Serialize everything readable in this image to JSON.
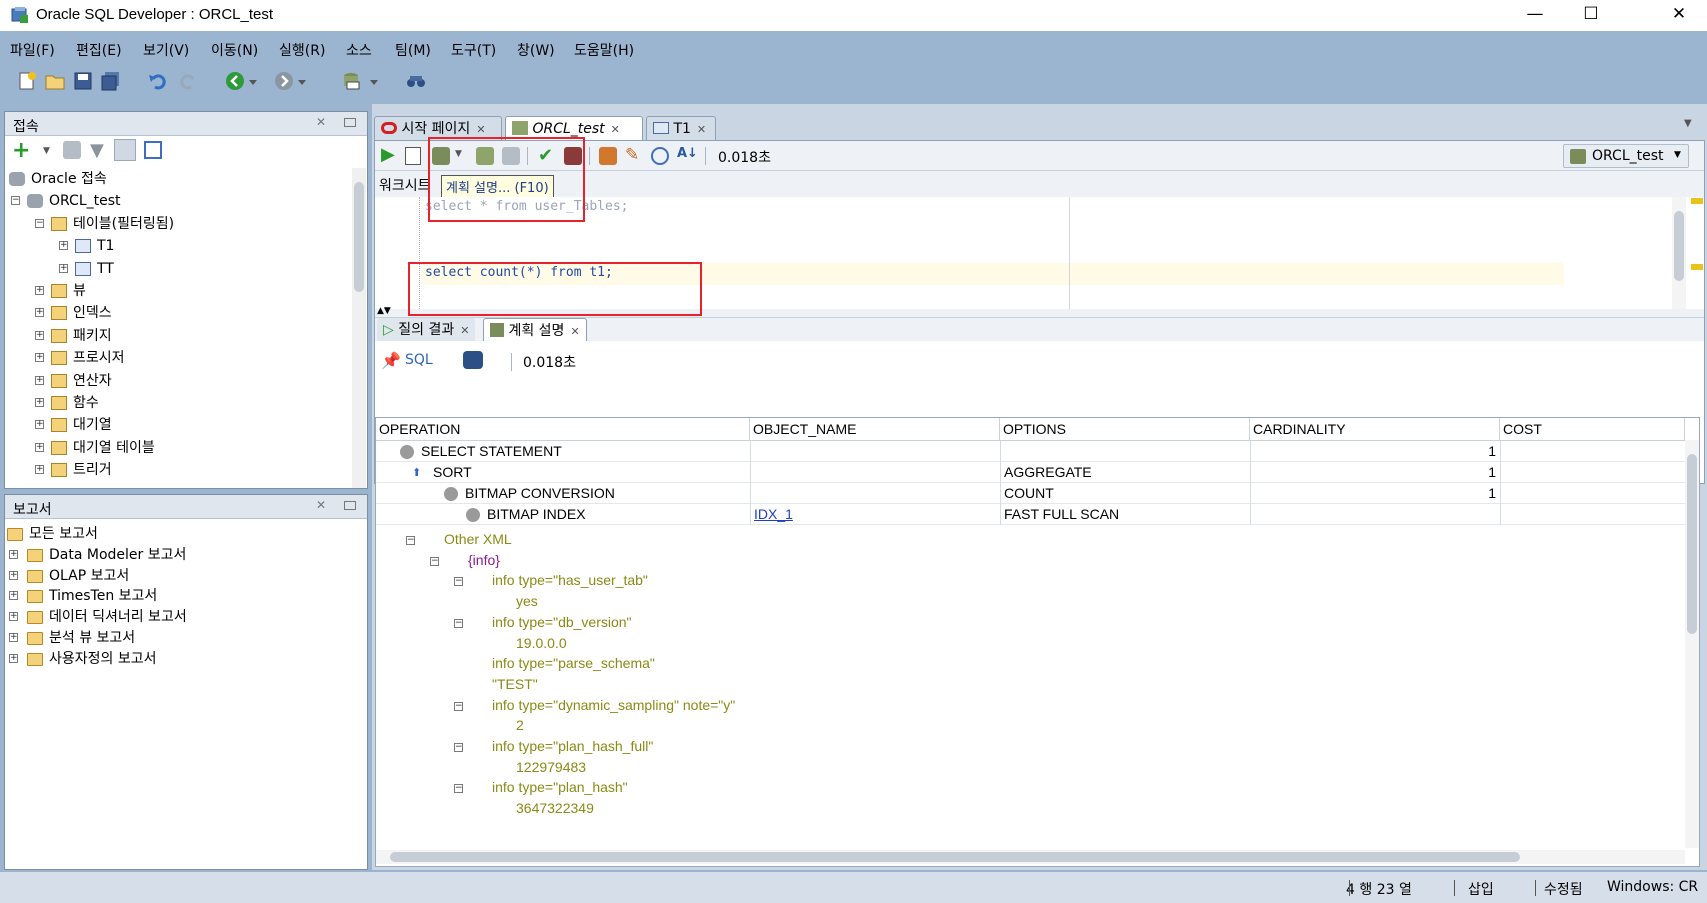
{
  "window": {
    "title": "Oracle SQL Developer : ORCL_test",
    "controls": [
      "—",
      "☐",
      "✕"
    ]
  },
  "menubar": [
    "파일(F)",
    "편집(E)",
    "보기(V)",
    "이동(N)",
    "실행(R)",
    "소스",
    "팀(M)",
    "도구(T)",
    "창(W)",
    "도움말(H)"
  ],
  "connections_panel": {
    "title": "접속",
    "tree": [
      {
        "label": "Oracle 접속",
        "level": 0
      },
      {
        "label": "ORCL_test",
        "level": 0
      },
      {
        "label": "테이블(필터링됨)",
        "level": 1
      },
      {
        "label": "T1",
        "level": 2
      },
      {
        "label": "TT",
        "level": 2
      },
      {
        "label": "뷰",
        "level": 1
      },
      {
        "label": "인덱스",
        "level": 1
      },
      {
        "label": "패키지",
        "level": 1
      },
      {
        "label": "프로시저",
        "level": 1
      },
      {
        "label": "연산자",
        "level": 1
      },
      {
        "label": "함수",
        "level": 1
      },
      {
        "label": "대기열",
        "level": 1
      },
      {
        "label": "대기열 테이블",
        "level": 1
      },
      {
        "label": "트리거",
        "level": 1
      }
    ]
  },
  "reports_panel": {
    "title": "보고서",
    "tree": [
      {
        "label": "모든 보고서"
      },
      {
        "label": "Data Modeler 보고서"
      },
      {
        "label": "OLAP 보고서"
      },
      {
        "label": "TimesTen 보고서"
      },
      {
        "label": "데이터 딕셔너리 보고서"
      },
      {
        "label": "분석 뷰 보고서"
      },
      {
        "label": "사용자정의 보고서"
      }
    ]
  },
  "editor_tabs": [
    {
      "label": "시작 페이지",
      "active": false
    },
    {
      "label": "ORCL_test",
      "active": true
    },
    {
      "label": "T1",
      "active": false
    }
  ],
  "worksheet": {
    "elapsed": "0.018초",
    "connection": "ORCL_test",
    "tab_label": "워크시트",
    "tooltip": "계획 설명... (F10)",
    "lines": [
      "select * from user_Tables;",
      "",
      "",
      "select count(*) from t1;"
    ]
  },
  "results": {
    "tabs": [
      {
        "label": "질의 결과",
        "active": false
      },
      {
        "label": "계획 설명",
        "active": true
      }
    ],
    "sql_label": "SQL",
    "elapsed": "0.018초",
    "columns": [
      "OPERATION",
      "OBJECT_NAME",
      "OPTIONS",
      "CARDINALITY",
      "COST"
    ],
    "rows": [
      {
        "operation": "SELECT STATEMENT",
        "object_name": "",
        "options": "",
        "cardinality": "1",
        "cost": ""
      },
      {
        "operation": "SORT",
        "object_name": "",
        "options": "AGGREGATE",
        "cardinality": "1",
        "cost": ""
      },
      {
        "operation": "BITMAP CONVERSION",
        "object_name": "",
        "options": "COUNT",
        "cardinality": "1",
        "cost": ""
      },
      {
        "operation": "BITMAP INDEX",
        "object_name": "IDX_1",
        "options": "FAST FULL SCAN",
        "cardinality": "",
        "cost": ""
      }
    ],
    "xml": [
      "Other XML",
      "{info}",
      "info type=\"has_user_tab\"",
      "yes",
      "info type=\"db_version\"",
      "19.0.0.0",
      "info type=\"parse_schema\"",
      "\"TEST\"",
      "info type=\"dynamic_sampling\" note=\"y\"",
      "2",
      "info type=\"plan_hash_full\"",
      "122979483",
      "info type=\"plan_hash\"",
      "3647322349"
    ]
  },
  "statusbar": {
    "position": "4 행 23 열",
    "mode": "삽입",
    "modified": "수정됨",
    "lineend": "Windows: CR"
  }
}
